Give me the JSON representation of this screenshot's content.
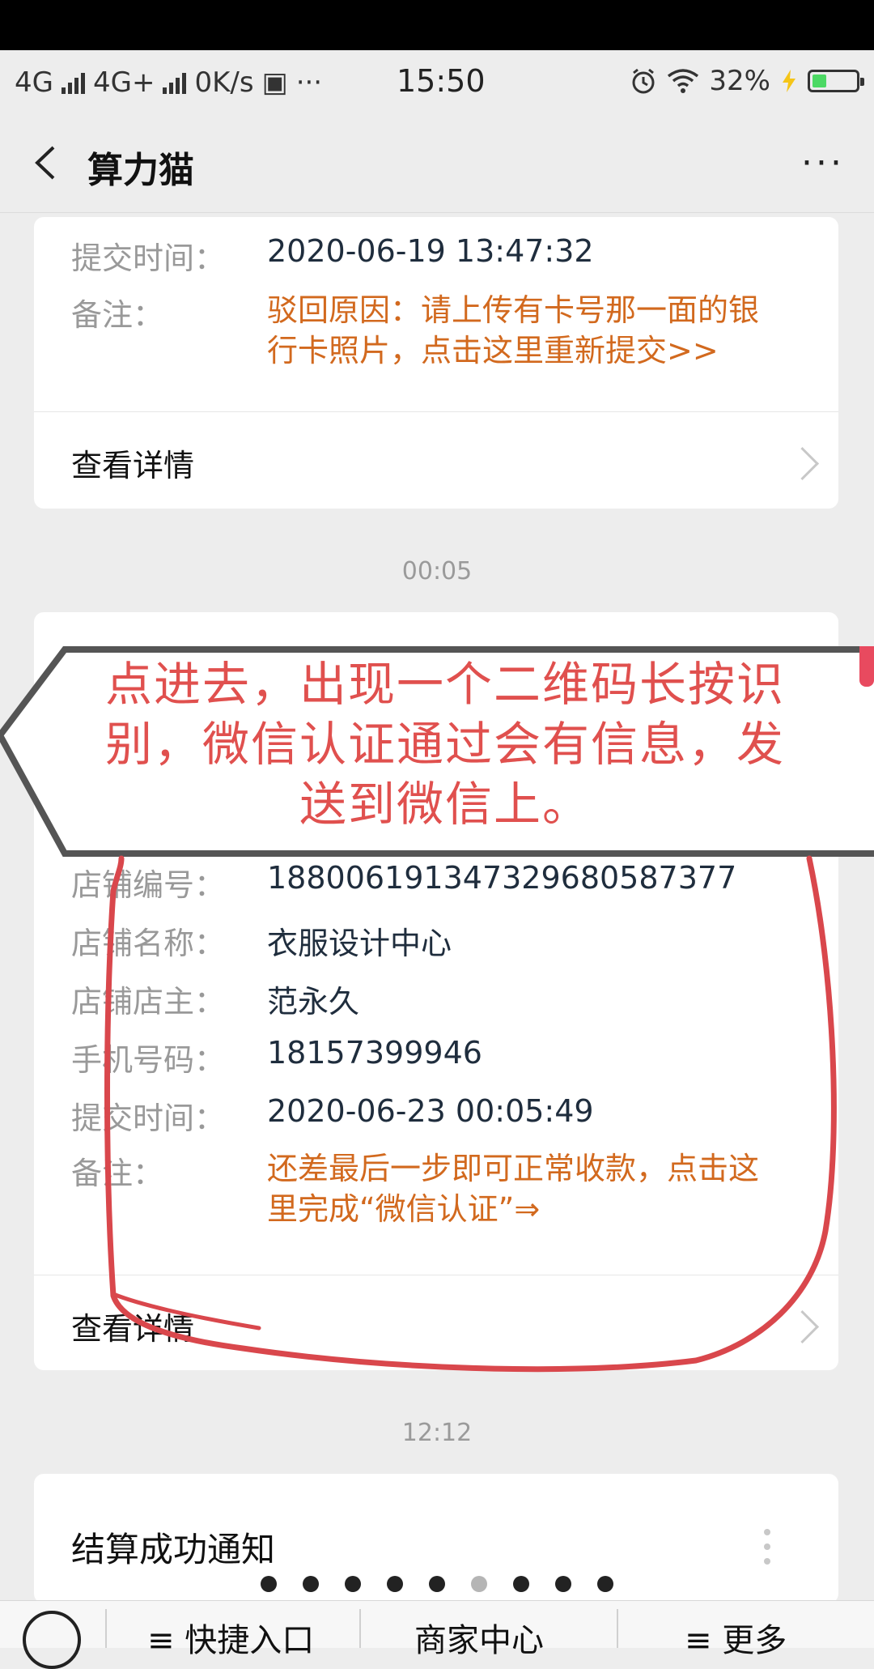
{
  "status_bar": {
    "network1": "4G",
    "network2": "4G+",
    "speed": "0K/s",
    "more": "···",
    "time": "15:50",
    "battery": "32%",
    "battery_level": 0.32,
    "colors": {
      "battery_fill": "#4cd964",
      "charging": "#f5c518"
    }
  },
  "nav": {
    "title": "算力猫",
    "more": "···"
  },
  "card1": {
    "submit_label": "提交时间：",
    "submit_time": "2020-06-19 13:47:32",
    "remark_label": "备注：",
    "remark_line1": "驳回原因：请上传有卡号那一面的银",
    "remark_line2": "行卡照片，点击这里重新提交>>",
    "detail": "查看详情"
  },
  "timestamp1": "00:05",
  "annotation": {
    "line1": "点进去，出现一个二维码长按识",
    "line2": "别，微信认证通过会有信息，发",
    "line3": "送到微信上。",
    "color": "#e0504e"
  },
  "card2": {
    "rows": [
      {
        "label": "店铺编号：",
        "value": "1880061913473296805873​77"
      },
      {
        "label": "店铺名称：",
        "value": "衣服设计中心"
      },
      {
        "label": "店铺店主：",
        "value": "范永久"
      },
      {
        "label": "手机号码：",
        "value": "18157399946"
      },
      {
        "label": "提交时间：",
        "value": "2020-06-23 00:05:49"
      }
    ],
    "remark_label": "备注：",
    "remark_line1": "还差最后一步即可正常收款，点击这",
    "remark_line2": "里完成“微信认证”⇒",
    "detail": "查看详情"
  },
  "timestamp2": "12:12",
  "card3": {
    "title": "结算成功通知"
  },
  "pager": {
    "count": 9,
    "active_index": 5
  },
  "bottom_bar": {
    "tab1": "≡ 快捷入口",
    "tab2": "商家中心",
    "tab3": "≡ 更多"
  }
}
